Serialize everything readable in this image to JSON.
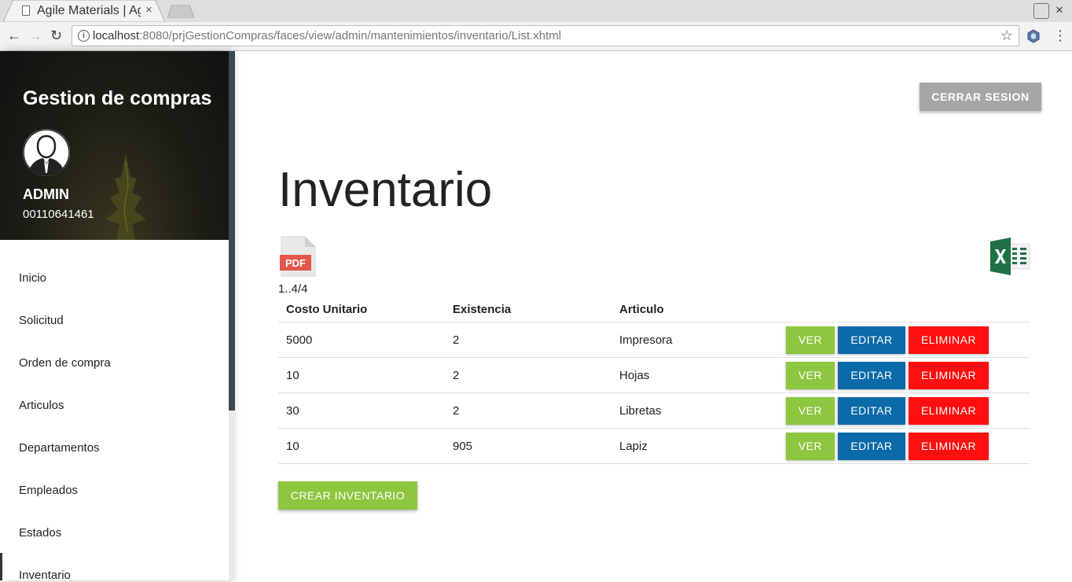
{
  "browser": {
    "tab_title": "Agile Materials | Agile",
    "tab_close": "×",
    "window_close": "×",
    "url_host": "localhost",
    "url_rest": ":8080/prjGestionCompras/faces/view/admin/mantenimientos/inventario/List.xhtml",
    "back": "←",
    "forward": "→",
    "reload": "↻",
    "star": "☆",
    "menu": "⋮",
    "info": "i"
  },
  "sidebar": {
    "app_title": "Gestion de compras",
    "user_name": "ADMIN",
    "user_id": "00110641461",
    "items": [
      {
        "label": "Inicio"
      },
      {
        "label": "Solicitud"
      },
      {
        "label": "Orden de compra"
      },
      {
        "label": "Articulos"
      },
      {
        "label": "Departamentos"
      },
      {
        "label": "Empleados"
      },
      {
        "label": "Estados"
      },
      {
        "label": "Inventario"
      }
    ]
  },
  "header": {
    "logout_label": "CERRAR SESION"
  },
  "main": {
    "title": "Inventario",
    "pdf_label": "PDF",
    "pager": "1..4/4",
    "columns": [
      "Costo Unitario",
      "Existencia",
      "Articulo"
    ],
    "rows": [
      {
        "costo": "5000",
        "existencia": "2",
        "articulo": "Impresora"
      },
      {
        "costo": "10",
        "existencia": "2",
        "articulo": "Hojas"
      },
      {
        "costo": "30",
        "existencia": "2",
        "articulo": "Libretas"
      },
      {
        "costo": "10",
        "existencia": "905",
        "articulo": "Lapiz"
      }
    ],
    "actions": {
      "view": "VER",
      "edit": "EDITAR",
      "delete": "ELIMINAR"
    },
    "create_label": "CREAR INVENTARIO"
  },
  "colors": {
    "view": "#8dc63f",
    "edit": "#0b6aa8",
    "delete": "#ff0f0f",
    "logout": "#a6a6a6",
    "sidebar_scroll": "#3b4a55"
  }
}
